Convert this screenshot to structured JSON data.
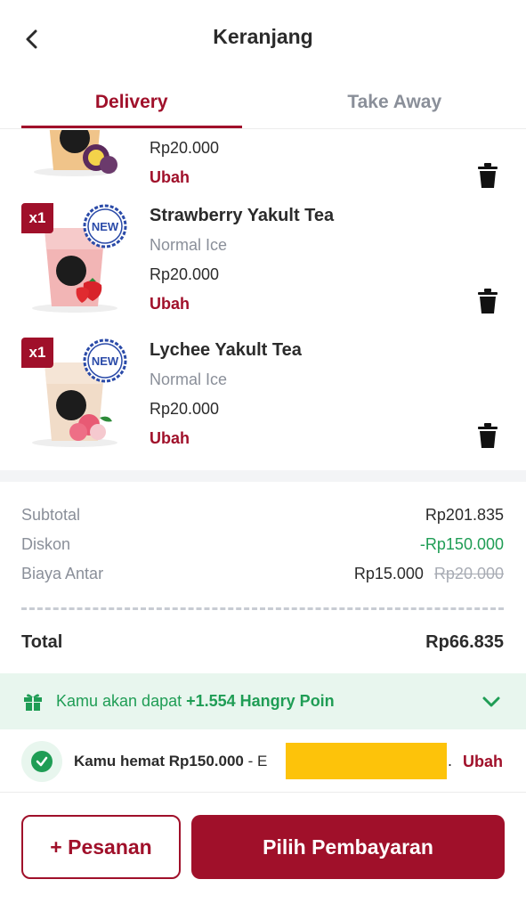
{
  "header": {
    "title": "Keranjang",
    "back_icon": "chevron-left-icon"
  },
  "tabs": [
    {
      "label": "Delivery",
      "active": true
    },
    {
      "label": "Take Away",
      "active": false
    }
  ],
  "cart": {
    "items": [
      {
        "name": "",
        "option": "",
        "price": "Rp20.000",
        "edit_label": "Ubah",
        "qty_label": "",
        "fruit": "passion-fruit"
      },
      {
        "name": "Strawberry Yakult Tea",
        "option": "Normal Ice",
        "price": "Rp20.000",
        "edit_label": "Ubah",
        "qty_label": "x1",
        "badge": "NEW",
        "fruit": "strawberry"
      },
      {
        "name": "Lychee Yakult Tea",
        "option": "Normal Ice",
        "price": "Rp20.000",
        "edit_label": "Ubah",
        "qty_label": "x1",
        "badge": "NEW",
        "fruit": "lychee"
      }
    ]
  },
  "summary": {
    "subtotal_label": "Subtotal",
    "subtotal_value": "Rp201.835",
    "discount_label": "Diskon",
    "discount_value": "-Rp150.000",
    "delivery_label": "Biaya Antar",
    "delivery_value": "Rp15.000",
    "delivery_original": "Rp20.000",
    "total_label": "Total",
    "total_value": "Rp66.835"
  },
  "points": {
    "prefix": "Kamu akan dapat ",
    "highlight": "+1.554 Hangry Poin"
  },
  "savings": {
    "text": "Kamu hemat Rp150.000",
    "promo_prefix": " - E",
    "dot": ".",
    "edit_label": "Ubah"
  },
  "actions": {
    "add_order_label": "+ Pesanan",
    "pay_label": "Pilih Pembayaran"
  },
  "colors": {
    "brand": "#a0102a",
    "green": "#1f9d55",
    "muted": "#8a8f99",
    "redaction": "#fdc30a"
  }
}
